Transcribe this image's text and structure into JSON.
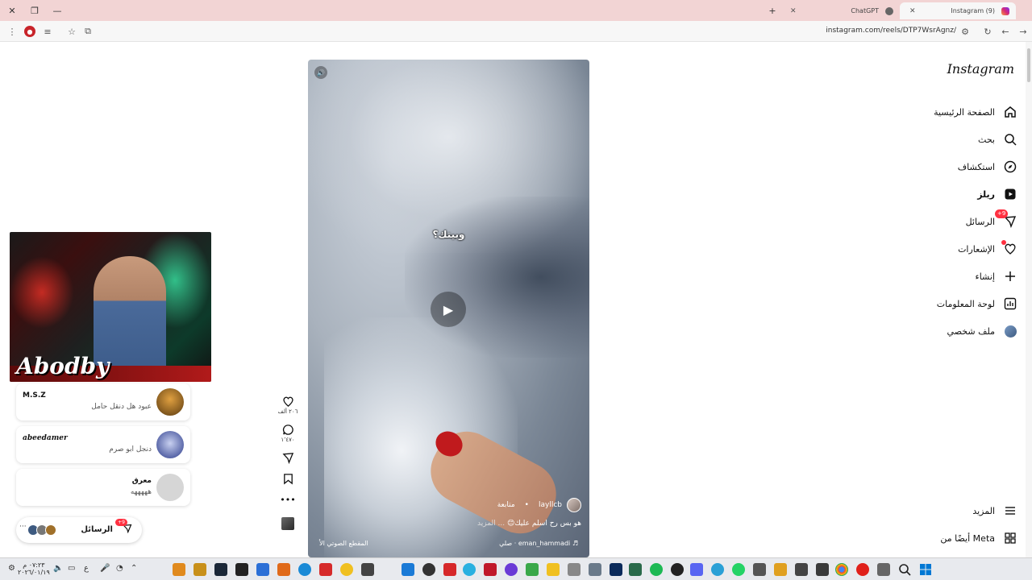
{
  "browser": {
    "tabs": [
      {
        "title": "(9) Instagram",
        "active": true
      },
      {
        "title": "ChatGPT",
        "active": false
      }
    ],
    "url": "instagram.com/reels/DTP7WsrAgnz/"
  },
  "sidebar": {
    "logo": "Instagram",
    "items": [
      {
        "label": "الصفحة الرئيسية",
        "icon": "home-icon"
      },
      {
        "label": "بحث",
        "icon": "search-icon"
      },
      {
        "label": "استكشاف",
        "icon": "compass-icon"
      },
      {
        "label": "ريلز",
        "icon": "reels-icon"
      },
      {
        "label": "الرسائل",
        "icon": "messenger-icon",
        "badge": "+9"
      },
      {
        "label": "الإشعارات",
        "icon": "heart-icon"
      },
      {
        "label": "إنشاء",
        "icon": "plus-icon"
      },
      {
        "label": "لوحة المعلومات",
        "icon": "dashboard-icon"
      },
      {
        "label": "ملف شخصي",
        "icon": "profile-avatar"
      }
    ],
    "bottom": [
      {
        "label": "المزيد",
        "icon": "menu-icon"
      },
      {
        "label": "أيضًا من Meta",
        "icon": "meta-apps-icon"
      }
    ]
  },
  "reel": {
    "overlay_text": "وبيتك؟",
    "author": "layllcb",
    "follow": "متابعة",
    "caption": "هو بس رح اسلم عليك😊",
    "more": "... المزيد",
    "audio_author": "eman_hammadi · صلي",
    "audio_original": "المقطع الصوتي الأ"
  },
  "actions": {
    "likes": "٢٠٦ ألف",
    "comments": "١٬٤٧٠"
  },
  "stream": {
    "brand": "Abodby"
  },
  "chats": [
    {
      "name": "M.S.Z",
      "message": "عبود هل دنقل حامل"
    },
    {
      "name": "abeedamer",
      "message": "دنجل ابو صرم"
    },
    {
      "name": "معرق",
      "message": "هههههه"
    }
  ],
  "messages_pill": {
    "label": "الرسائل",
    "badge": "+9"
  },
  "taskbar": {
    "time": "٠٧:٢٣ م",
    "date": "٢٠٢٦/٠١/١٩",
    "lang": "ع"
  },
  "colors": {
    "tabbar": "#f2d4d4",
    "accent_red": "#ff3040",
    "page_bg": "#ffffff"
  }
}
